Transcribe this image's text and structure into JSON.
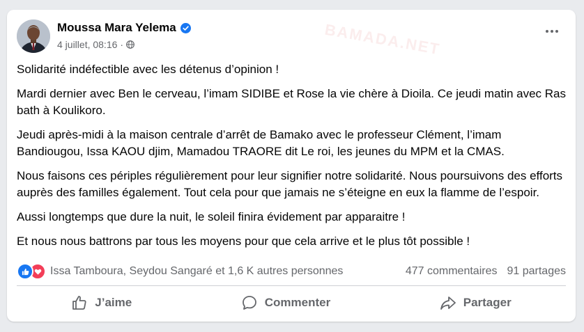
{
  "post": {
    "author": "Moussa Mara Yelema",
    "date": "4 juillet, 08:16",
    "watermark": "BAMADA.NET",
    "paragraphs": [
      "Solidarité indéfectible avec les détenus d’opinion !",
      "Mardi dernier avec Ben le cerveau, l’imam SIDIBE et Rose la vie chère à Dioila. Ce jeudi matin avec Ras bath à Koulikoro.",
      "Jeudi après-midi à la maison centrale d’arrêt de Bamako avec le professeur Clément, l’imam Bandiougou, Issa KAOU djim, Mamadou TRAORE dit Le roi, les jeunes du MPM et la CMAS.",
      "Nous faisons ces périples régulièrement pour leur signifier notre solidarité. Nous poursuivons des efforts auprès des familles également. Tout cela pour que jamais ne s’éteigne en eux la flamme de l’espoir.",
      "Aussi longtemps que dure la nuit, le soleil finira évidement par apparaitre !",
      "Et nous nous battrons par tous les moyens pour que cela arrive et le plus tôt possible !"
    ]
  },
  "reactions": {
    "names": "Issa Tamboura, Seydou Sangaré et 1,6 K autres personnes",
    "comments": "477 commentaires",
    "shares": "91 partages"
  },
  "actions": {
    "like": "J’aime",
    "comment": "Commenter",
    "share": "Partager"
  },
  "colors": {
    "like_blue": "#1877f2",
    "love_red": "#f33e58",
    "secondary_text": "#65676b"
  }
}
